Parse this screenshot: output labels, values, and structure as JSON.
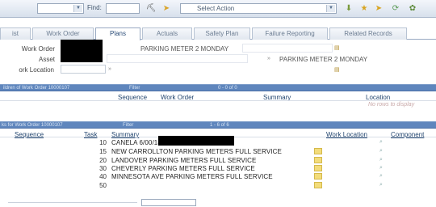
{
  "toolbar": {
    "find_label": "Find:",
    "select_action": "Select Action"
  },
  "tabs": [
    {
      "label": "ist"
    },
    {
      "label": "Work Order"
    },
    {
      "label": "Plans"
    },
    {
      "label": "Actuals"
    },
    {
      "label": "Safety Plan"
    },
    {
      "label": "Failure Reporting"
    },
    {
      "label": "Related Records"
    }
  ],
  "header": {
    "work_order_label": "Work Order",
    "work_order_desc": "PARKING METER 2 MONDAY",
    "asset_label": "Asset",
    "asset_desc": "PARKING METER 2 MONDAY",
    "work_location_label": "ork Location"
  },
  "children_section": {
    "title": "ildren of Work Order 10000107",
    "filter": "Filter",
    "count": "0 - 0 of 0",
    "columns": [
      "Sequence",
      "Work Order",
      "Summary",
      "Location"
    ],
    "empty_text": "No rows to display"
  },
  "tasks_section": {
    "title": "ks for Work Order 10000107",
    "filter": "Filter",
    "count": "1 - 6 of 6",
    "columns": [
      "Sequence",
      "Task",
      "Summary",
      "Work Location",
      "Component"
    ],
    "rows": [
      {
        "task": "10",
        "summary": "CANELA 6/00/14 VEHICL"
      },
      {
        "task": "15",
        "summary": "NEW CARROLLTON PARKING METERS FULL SERVICE"
      },
      {
        "task": "20",
        "summary": "LANDOVER PARKING METERS FULL SERVICE"
      },
      {
        "task": "30",
        "summary": "CHEVERLY PARKING METERS FULL SERVICE"
      },
      {
        "task": "40",
        "summary": "MINNESOTA AVE PARKING METERS FULL SERVICE"
      },
      {
        "task": "50",
        "summary": ""
      }
    ]
  },
  "icons": [
    "dropdown-arrow-icon",
    "binoculars-icon",
    "arrow-right-icon",
    "star-icon",
    "refresh-icon",
    "lookup-icon"
  ],
  "colors": {
    "section_bar": "#5f86bd",
    "toolbar": "#d7e0ec",
    "active_tab_text": "#2b4d78"
  }
}
